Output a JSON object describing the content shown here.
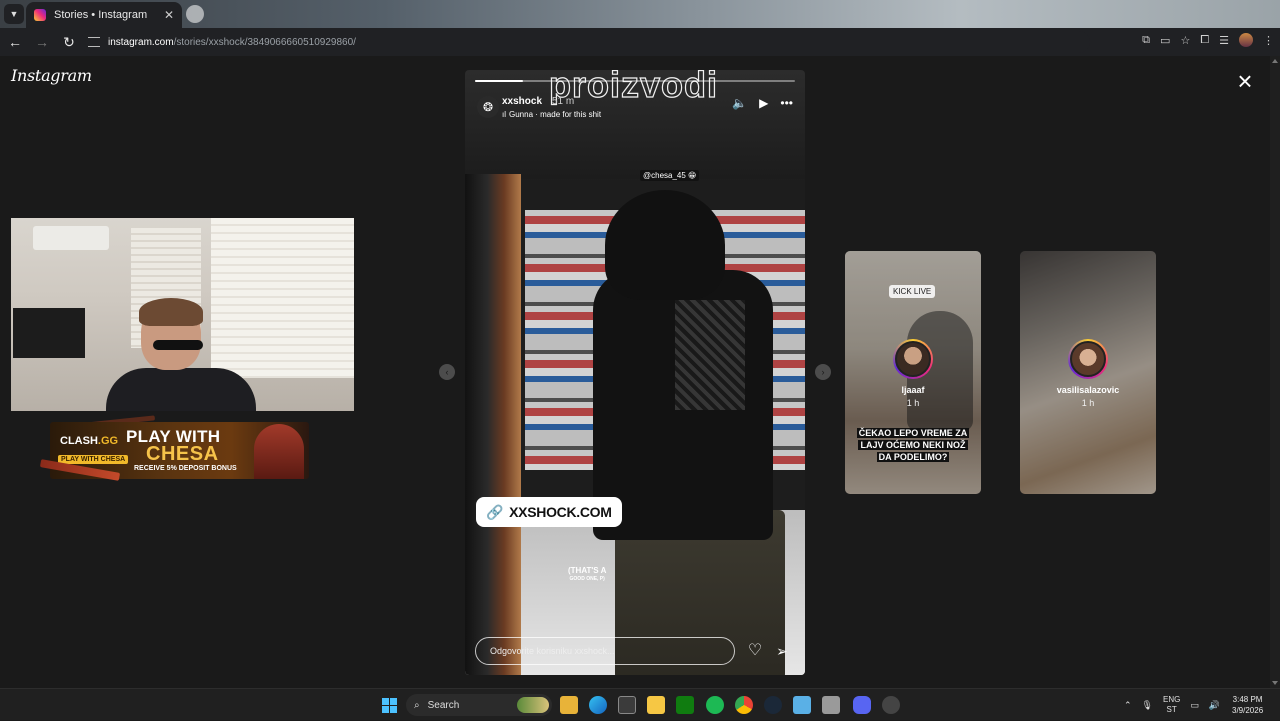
{
  "browser": {
    "tab_title": "Stories • Instagram",
    "url_host": "instagram.com",
    "url_path": "/stories/xxshock/3849066660510929860/"
  },
  "page": {
    "logo": "Instagram"
  },
  "sponsor": {
    "brand_prefix": "CLASH",
    "brand_suffix": ".GG",
    "chip": "PLAY WITH CHESA",
    "headline_1": "PLAY WITH",
    "headline_2": "CHESA",
    "subline": "RECEIVE 5% DEPOSIT BONUS"
  },
  "story": {
    "overlay_word": "proizvodi",
    "username": "xxshock",
    "time": "51 m",
    "music": "Gunna · made for this shit",
    "mention": "@chesa_45 😁",
    "link_text": "XXSHOCK.COM",
    "caption_1": "(THAT'S A",
    "caption_2": "GOOD ONE, P)",
    "reply_placeholder": "Odgovorite korisniku xxshock...",
    "progress": 0.15
  },
  "upcoming": [
    {
      "username": "ljaaaf",
      "time": "1 h",
      "badge": "KICK LIVE",
      "sticker": "ČEKAO LEPO VREME ZA LAJV OĆEMO NEKI NOŽ DA PODELIMO?"
    },
    {
      "username": "vasilisalazovic",
      "time": "1 h"
    }
  ],
  "taskbar": {
    "search_label": "Search",
    "lang_1": "ENG",
    "lang_2": "ST",
    "time": "3:48 PM",
    "date": "3/9/2026"
  },
  "colors": {
    "accent": "#4cc2ff",
    "ig_gradient": [
      "#f9ce34",
      "#ee2a7b",
      "#6228d7"
    ],
    "link_icon": "#6b2bd8"
  }
}
